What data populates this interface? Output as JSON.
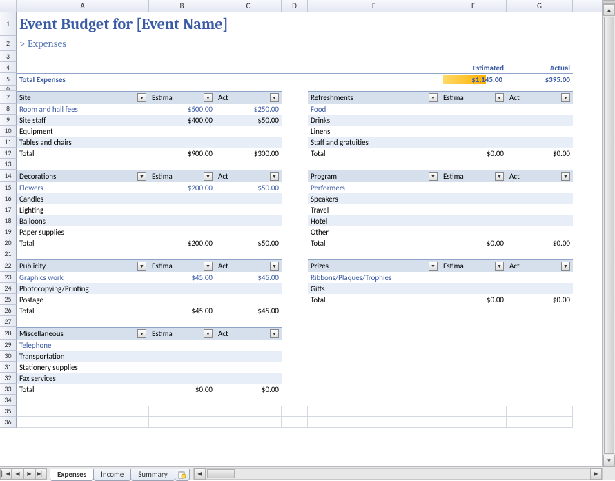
{
  "columns": [
    "A",
    "B",
    "C",
    "D",
    "E",
    "F",
    "G"
  ],
  "title": "Event Budget for [Event Name]",
  "subtitle": "> Expenses",
  "summary": {
    "est_label": "Estimated",
    "act_label": "Actual",
    "total_label": "Total Expenses",
    "est_total": "$1,145.00",
    "act_total": "$395.00"
  },
  "col_headers": {
    "name": "",
    "est": "Estima",
    "act": "Act"
  },
  "left_sections": [
    {
      "name": "Site",
      "rows": [
        {
          "label": "Room and hall fees",
          "est": "$500.00",
          "act": "$250.00",
          "link": true
        },
        {
          "label": "Site staff",
          "est": "$400.00",
          "act": "$50.00"
        },
        {
          "label": "Equipment"
        },
        {
          "label": "Tables and chairs"
        }
      ],
      "total": {
        "label": "Total",
        "est": "$900.00",
        "act": "$300.00"
      }
    },
    {
      "name": "Decorations",
      "rows": [
        {
          "label": "Flowers",
          "est": "$200.00",
          "act": "$50.00",
          "link": true
        },
        {
          "label": "Candles"
        },
        {
          "label": "Lighting"
        },
        {
          "label": "Balloons"
        },
        {
          "label": "Paper supplies"
        }
      ],
      "total": {
        "label": "Total",
        "est": "$200.00",
        "act": "$50.00"
      }
    },
    {
      "name": "Publicity",
      "rows": [
        {
          "label": "Graphics work",
          "est": "$45.00",
          "act": "$45.00",
          "link": true
        },
        {
          "label": "Photocopying/Printing"
        },
        {
          "label": "Postage"
        }
      ],
      "total": {
        "label": "Total",
        "est": "$45.00",
        "act": "$45.00"
      }
    },
    {
      "name": "Miscellaneous",
      "rows": [
        {
          "label": "Telephone",
          "link": true
        },
        {
          "label": "Transportation"
        },
        {
          "label": "Stationery supplies"
        },
        {
          "label": "Fax services"
        }
      ],
      "total": {
        "label": "Total",
        "est": "$0.00",
        "act": "$0.00"
      }
    }
  ],
  "right_sections": [
    {
      "name": "Refreshments",
      "rows": [
        {
          "label": "Food",
          "link": true
        },
        {
          "label": "Drinks"
        },
        {
          "label": "Linens"
        },
        {
          "label": "Staff and gratuities"
        }
      ],
      "total": {
        "label": "Total",
        "est": "$0.00",
        "act": "$0.00"
      }
    },
    {
      "name": "Program",
      "rows": [
        {
          "label": "Performers",
          "link": true
        },
        {
          "label": "Speakers"
        },
        {
          "label": "Travel"
        },
        {
          "label": "Hotel"
        },
        {
          "label": "Other"
        }
      ],
      "total": {
        "label": "Total",
        "est": "$0.00",
        "act": "$0.00"
      }
    },
    {
      "name": "Prizes",
      "rows": [
        {
          "label": "Ribbons/Plaques/Trophies",
          "link": true
        },
        {
          "label": "Gifts"
        }
      ],
      "total": {
        "label": "Total",
        "est": "$0.00",
        "act": "$0.00"
      }
    }
  ],
  "sheet_tabs": [
    "Expenses",
    "Income",
    "Summary"
  ],
  "active_tab": "Expenses",
  "glyphs": {
    "dropdown": "▼",
    "first": "▏◀",
    "prev": "◀",
    "next": "▶",
    "last": "▶▏",
    "up": "▲",
    "down": "▼",
    "left": "◀",
    "right": "▶"
  }
}
